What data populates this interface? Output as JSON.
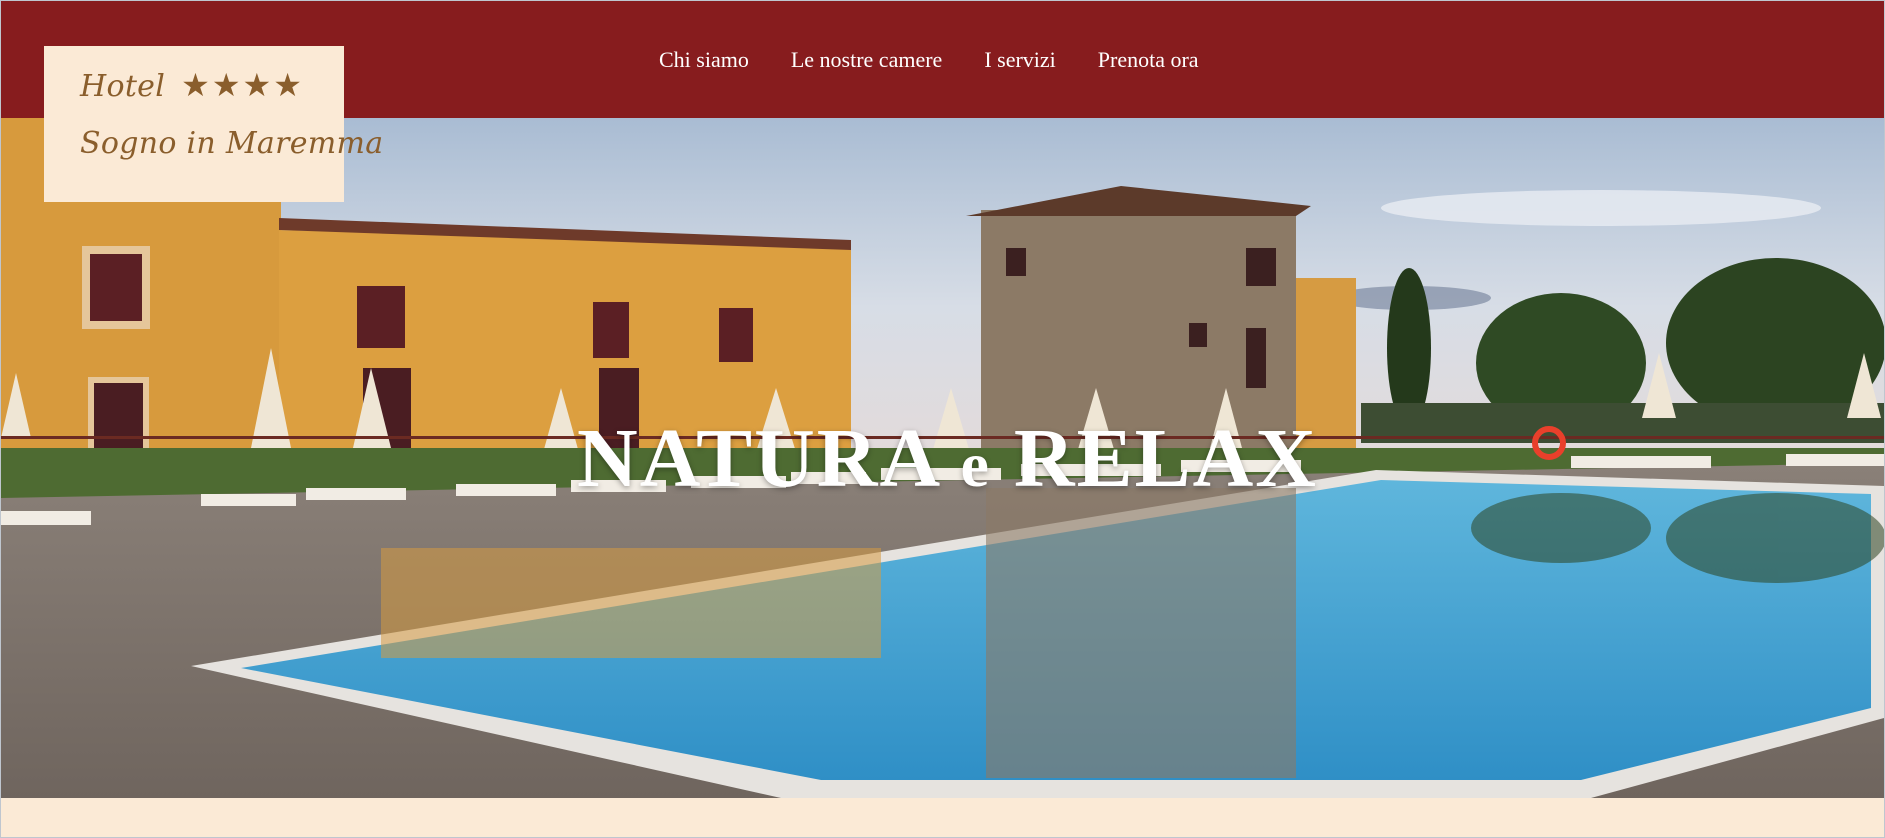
{
  "brand": {
    "line1": "Hotel",
    "stars": "★★★★",
    "line2": "Sogno in Maremma"
  },
  "nav": {
    "items": [
      {
        "label": "Chi siamo"
      },
      {
        "label": "Le nostre camere"
      },
      {
        "label": "I servizi"
      },
      {
        "label": "Prenota ora"
      }
    ]
  },
  "hero": {
    "title_part1": "NATURA",
    "title_part2": "e",
    "title_part3": "RELAX"
  },
  "colors": {
    "header": "#871c1e",
    "cream": "#fbead6",
    "logo_text": "#8a5e2c"
  }
}
